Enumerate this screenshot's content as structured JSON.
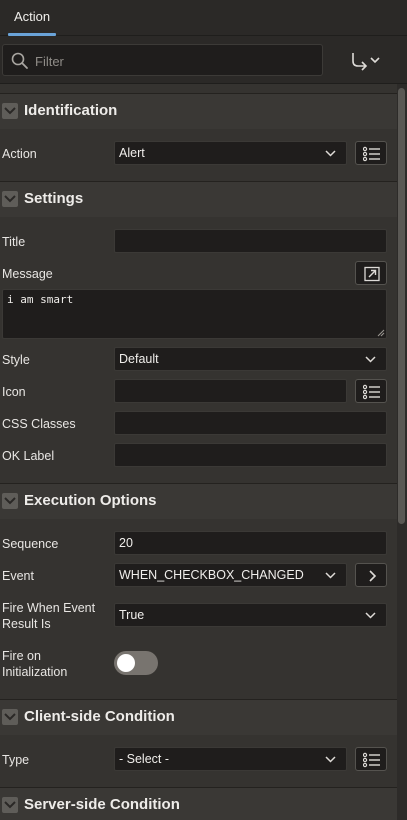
{
  "tabs": [
    {
      "label": "Action"
    }
  ],
  "filter": {
    "placeholder": "Filter"
  },
  "sections": {
    "identification": {
      "title": "Identification",
      "action_label": "Action",
      "action_value": "Alert"
    },
    "settings": {
      "title": "Settings",
      "title_label": "Title",
      "title_value": "",
      "message_label": "Message",
      "message_value": "i am smart",
      "style_label": "Style",
      "style_value": "Default",
      "icon_label": "Icon",
      "icon_value": "",
      "css_label": "CSS Classes",
      "css_value": "",
      "ok_label": "OK Label",
      "ok_value": ""
    },
    "execution": {
      "title": "Execution Options",
      "sequence_label": "Sequence",
      "sequence_value": "20",
      "event_label": "Event",
      "event_value": "WHEN_CHECKBOX_CHANGED",
      "fire_when_label_1": "Fire When Event",
      "fire_when_label_2": "Result Is",
      "fire_when_value": "True",
      "fire_init_label_1": "Fire on",
      "fire_init_label_2": "Initialization",
      "fire_init_on": false
    },
    "client_condition": {
      "title": "Client-side Condition",
      "type_label": "Type",
      "type_value": "- Select -"
    },
    "server_condition": {
      "title": "Server-side Condition"
    }
  },
  "colors": {
    "background": "#353330",
    "header": "#3a3835",
    "field": "#1f1d1c",
    "accent": "#6aa3d8",
    "toggle_off": "#78746f"
  },
  "icons": [
    "search-icon",
    "goto-arrow-icon",
    "chevron-down-icon",
    "list-icon",
    "open-dialog-icon",
    "chevron-right-icon",
    "collapse-icon"
  ]
}
